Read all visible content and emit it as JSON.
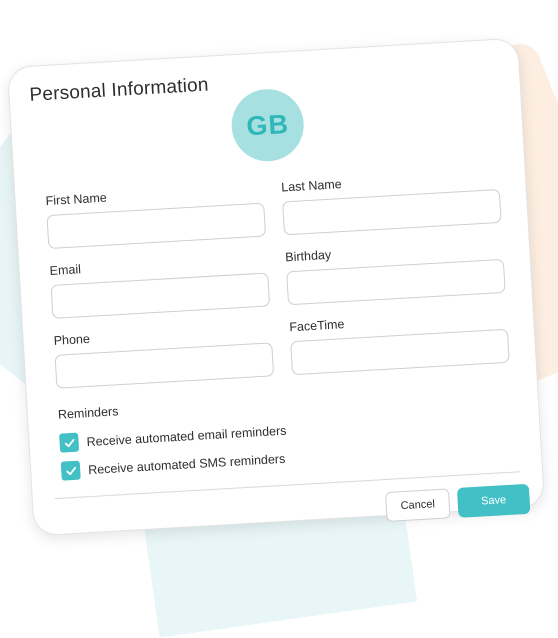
{
  "colors": {
    "accent": "#43c0c6",
    "avatar_bg": "#a6e0e1",
    "avatar_text": "#2fb7b9"
  },
  "form": {
    "title": "Personal Information",
    "avatar_initials": "GB",
    "fields": [
      {
        "label": "First Name",
        "value": "",
        "placeholder": ""
      },
      {
        "label": "Last Name",
        "value": "",
        "placeholder": ""
      },
      {
        "label": "Email",
        "value": "",
        "placeholder": ""
      },
      {
        "label": "Birthday",
        "value": "",
        "placeholder": ""
      },
      {
        "label": "Phone",
        "value": "",
        "placeholder": ""
      },
      {
        "label": "FaceTime",
        "value": "",
        "placeholder": ""
      }
    ],
    "reminders": {
      "title": "Reminders",
      "options": [
        {
          "label": "Receive automated email reminders",
          "checked": true
        },
        {
          "label": "Receive automated SMS reminders",
          "checked": true
        }
      ]
    },
    "buttons": {
      "cancel": "Cancel",
      "save": "Save"
    }
  }
}
